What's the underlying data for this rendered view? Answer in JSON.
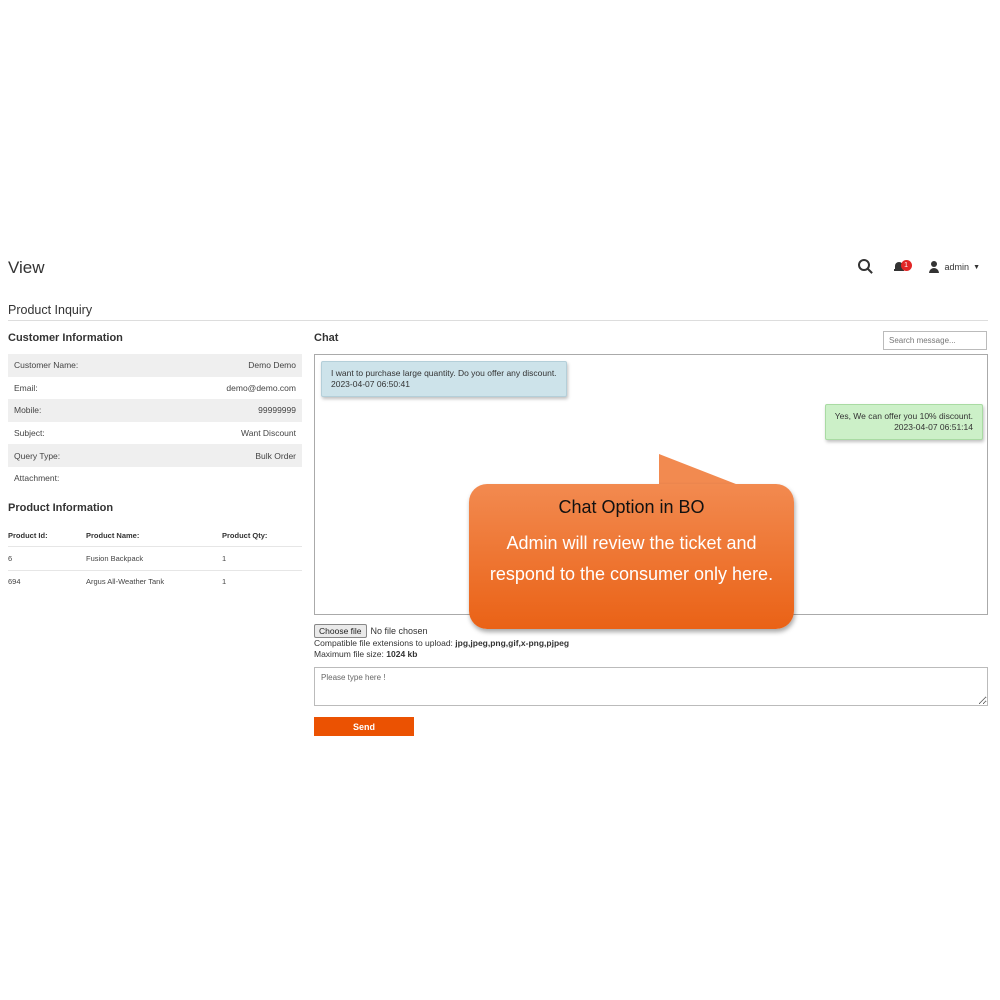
{
  "header": {
    "page_title": "View",
    "notification_count": "1",
    "user_name": "admin",
    "user_caret": "▼",
    "icons": [
      "search-icon",
      "bell-icon",
      "user-icon",
      "caret-down-icon"
    ]
  },
  "section_title": "Product Inquiry",
  "customer": {
    "title": "Customer Information",
    "rows": [
      {
        "label": "Customer Name:",
        "value": "Demo Demo"
      },
      {
        "label": "Email:",
        "value": "demo@demo.com"
      },
      {
        "label": "Mobile:",
        "value": "99999999"
      },
      {
        "label": "Subject:",
        "value": "Want Discount"
      },
      {
        "label": "Query Type:",
        "value": "Bulk Order"
      },
      {
        "label": "Attachment:",
        "value": ""
      }
    ]
  },
  "product": {
    "title": "Product Information",
    "headers": [
      "Product Id:",
      "Product Name:",
      "Product Qty:"
    ],
    "rows": [
      [
        "6",
        "Fusion Backpack",
        "1"
      ],
      [
        "694",
        "Argus All-Weather Tank",
        "1"
      ]
    ]
  },
  "chat": {
    "title": "Chat",
    "search_placeholder": "Search message...",
    "messages": [
      {
        "text": "I want to purchase large quantity. Do you offer any discount.",
        "time": "2023-04-07 06:50:41"
      },
      {
        "text": "Yes, We can offer you 10% discount.",
        "time": "2023-04-07 06:51:14"
      }
    ],
    "file_button": "Choose file",
    "file_status": "No file chosen",
    "ext_label": "Compatible file extensions to upload: ",
    "ext_value": "jpg,jpeg,png,gif,x-png,pjpeg",
    "size_label": "Maximum file size: ",
    "size_value": "1024 kb",
    "message_placeholder": "Please type here !",
    "send_label": "Send"
  },
  "callout": {
    "title": "Chat Option in BO",
    "body": "Admin will review the ticket and respond to the consumer only here."
  },
  "colors": {
    "accent": "#eb5202",
    "callout": "#ed7030",
    "incoming_bubble": "#cde3ea",
    "outgoing_bubble": "#ccf0c8",
    "badge": "#e22626"
  }
}
